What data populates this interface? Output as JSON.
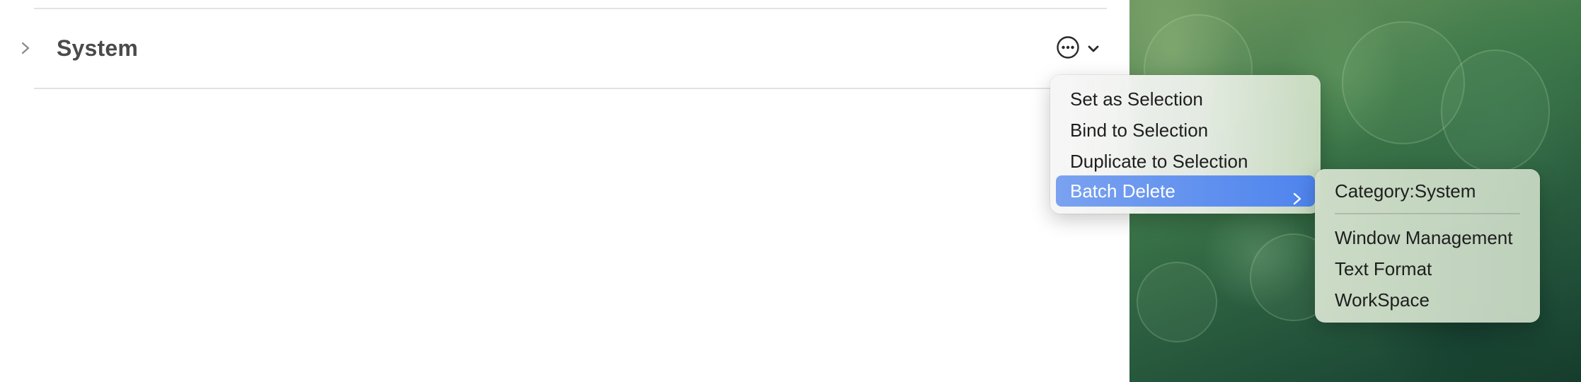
{
  "section": {
    "title": "System"
  },
  "context_menu": {
    "items": [
      {
        "label": "Set as Selection"
      },
      {
        "label": "Bind to Selection"
      },
      {
        "label": "Duplicate to Selection"
      },
      {
        "label": "Batch Delete",
        "highlighted": true,
        "has_submenu": true
      }
    ]
  },
  "submenu": {
    "header": "Category:System",
    "items": [
      {
        "label": "Window Management"
      },
      {
        "label": "Text Format"
      },
      {
        "label": "WorkSpace"
      }
    ]
  },
  "colors": {
    "highlight": "#4e84ee",
    "title_text": "#4a4a4a"
  },
  "icons": {
    "row_chevron": "chevron-right-icon",
    "more": "ellipsis-circle-icon",
    "more_dropdown": "chevron-down-icon",
    "submenu_arrow": "chevron-right-icon"
  }
}
